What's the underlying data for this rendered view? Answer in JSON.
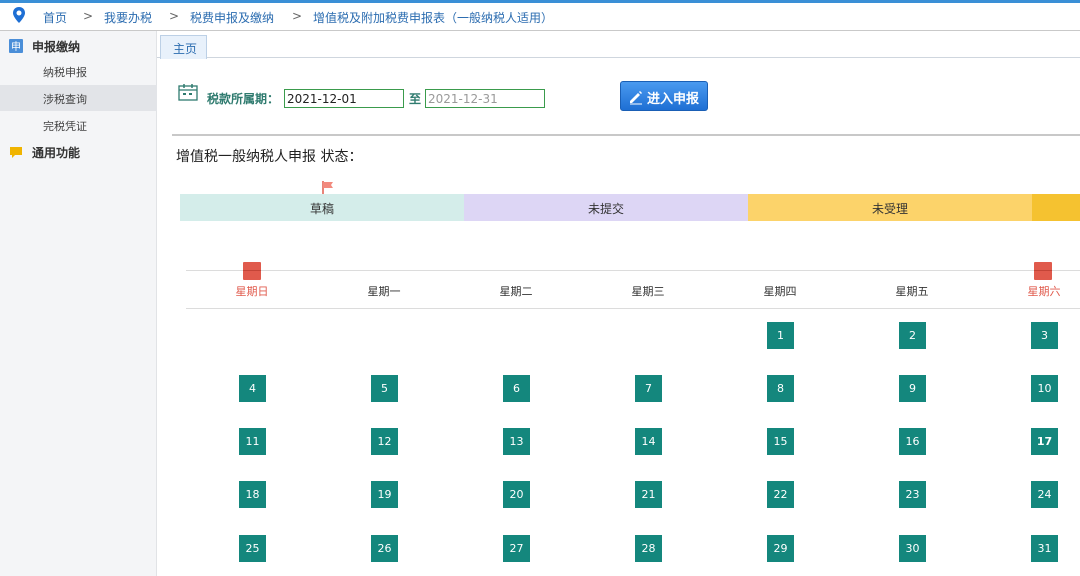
{
  "breadcrumb": [
    "首页",
    "我要办税",
    "税费申报及缴纳",
    "增值税及附加税费申报表（一般纳税人适用）"
  ],
  "breadcrumb_separator": ">",
  "sidebar": {
    "sections": [
      {
        "label": "申报缴纳",
        "icon": "shen-badge-icon",
        "items": [
          {
            "label": "纳税申报"
          },
          {
            "label": "涉税查询",
            "active": true
          },
          {
            "label": "完税凭证"
          }
        ]
      },
      {
        "label": "通用功能",
        "icon": "speech-bubble-icon",
        "items": []
      }
    ]
  },
  "tabs": [
    {
      "label": "主页"
    }
  ],
  "period": {
    "label": "税款所属期：",
    "start": "2021-12-01",
    "separator": "至",
    "end": "2021-12-31"
  },
  "enter_button": {
    "label": "进入申报",
    "icon": "pencil-icon"
  },
  "status_title": "增值税一般纳税人申报 状态：",
  "statuses": [
    {
      "label": "草稿",
      "color": "#d4edea"
    },
    {
      "label": "未提交",
      "color": "#ddd6f5"
    },
    {
      "label": "未受理",
      "color": "#fcd36a"
    },
    {
      "label": "",
      "color": "#f5c230"
    }
  ],
  "calendar": {
    "weekdays": [
      "星期日",
      "星期一",
      "星期二",
      "星期三",
      "星期四",
      "星期五",
      "星期六"
    ],
    "weeks": [
      [
        null,
        null,
        null,
        null,
        "1",
        "2",
        "3"
      ],
      [
        "4",
        "5",
        "6",
        "7",
        "8",
        "9",
        "10"
      ],
      [
        "11",
        "12",
        "13",
        "14",
        "15",
        "16",
        "17"
      ],
      [
        "18",
        "19",
        "20",
        "21",
        "22",
        "23",
        "24"
      ],
      [
        "25",
        "26",
        "27",
        "28",
        "29",
        "30",
        "31"
      ]
    ],
    "highlight_day": "17"
  },
  "colors": {
    "accent": "#3a8fd6",
    "calendar_day": "#14877d",
    "weekend_text": "#e05a4c",
    "label_green": "#2f7b6f"
  }
}
